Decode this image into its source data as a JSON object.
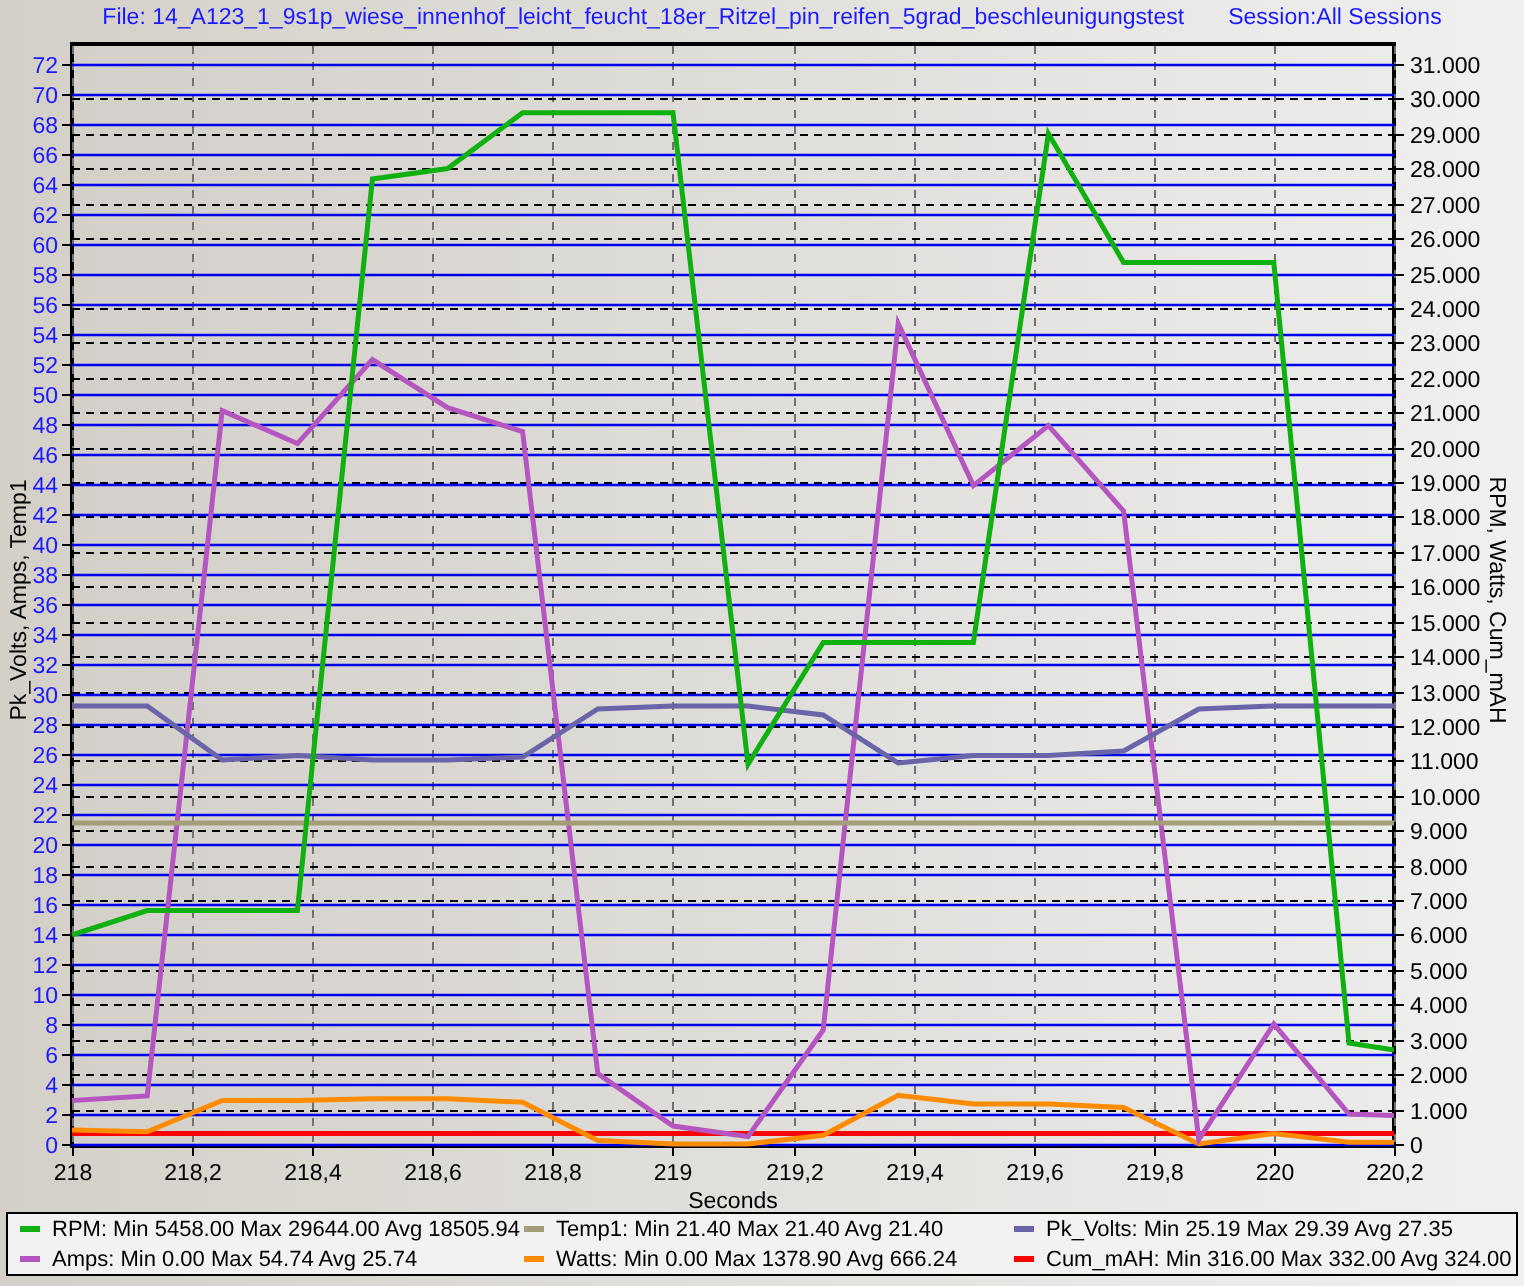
{
  "header": {
    "file": "File: 14_A123_1_9s1p_wiese_innenhof_leicht_feucht_18er_Ritzel_pin_reifen_5grad_beschleunigungstest",
    "session": "Session:All Sessions"
  },
  "chart": {
    "chart_data": {
      "type": "line",
      "grid": true,
      "xlabel": "Seconds",
      "ylabel": "Pk_Volts, Amps, Temp1",
      "y2label": "RPM, Watts, Cum_mAH",
      "x": [
        218,
        218.125,
        218.25,
        218.375,
        218.5,
        218.625,
        218.75,
        218.875,
        219,
        219.125,
        219.25,
        219.375,
        219.5,
        219.625,
        219.75,
        219.875,
        220,
        220.125,
        220.2
      ],
      "xlim": [
        218,
        220.2
      ],
      "xticks": [
        218,
        {
          "value": 218.2,
          "label": "218,2"
        },
        {
          "value": 218.4,
          "label": "218,4"
        },
        {
          "value": 218.6,
          "label": "218,6"
        },
        {
          "value": 218.8,
          "label": "218,8"
        },
        219,
        {
          "value": 219.2,
          "label": "219,2"
        },
        {
          "value": 219.4,
          "label": "219,4"
        },
        {
          "value": 219.6,
          "label": "219,6"
        },
        {
          "value": 219.8,
          "label": "219,8"
        },
        220,
        {
          "value": 220.2,
          "label": "220,2"
        }
      ],
      "ylim": [
        0,
        72
      ],
      "yticks": [
        0,
        2,
        4,
        6,
        8,
        10,
        12,
        14,
        16,
        18,
        20,
        22,
        24,
        26,
        28,
        30,
        32,
        34,
        36,
        38,
        40,
        42,
        44,
        46,
        48,
        50,
        52,
        54,
        56,
        58,
        60,
        62,
        64,
        66,
        68,
        70,
        72
      ],
      "y2lim": [
        0,
        31000
      ],
      "y2ticks": [
        0,
        {
          "value": 1000,
          "label": "1.000"
        },
        {
          "value": 2000,
          "label": "2.000"
        },
        {
          "value": 3000,
          "label": "3.000"
        },
        {
          "value": 4000,
          "label": "4.000"
        },
        {
          "value": 5000,
          "label": "5.000"
        },
        {
          "value": 6000,
          "label": "6.000"
        },
        {
          "value": 7000,
          "label": "7.000"
        },
        {
          "value": 8000,
          "label": "8.000"
        },
        {
          "value": 9000,
          "label": "9.000"
        },
        {
          "value": 10000,
          "label": "10.000"
        },
        {
          "value": 11000,
          "label": "11.000"
        },
        {
          "value": 12000,
          "label": "12.000"
        },
        {
          "value": 13000,
          "label": "13.000"
        },
        {
          "value": 14000,
          "label": "14.000"
        },
        {
          "value": 15000,
          "label": "15.000"
        },
        {
          "value": 16000,
          "label": "16.000"
        },
        {
          "value": 17000,
          "label": "17.000"
        },
        {
          "value": 18000,
          "label": "18.000"
        },
        {
          "value": 19000,
          "label": "19.000"
        },
        {
          "value": 20000,
          "label": "20.000"
        },
        {
          "value": 21000,
          "label": "21.000"
        },
        {
          "value": 22000,
          "label": "22.000"
        },
        {
          "value": 23000,
          "label": "23.000"
        },
        {
          "value": 24000,
          "label": "24.000"
        },
        {
          "value": 25000,
          "label": "25.000"
        },
        {
          "value": 26000,
          "label": "26.000"
        },
        {
          "value": 27000,
          "label": "27.000"
        },
        {
          "value": 28000,
          "label": "28.000"
        },
        {
          "value": 29000,
          "label": "29.000"
        },
        {
          "value": 30000,
          "label": "30.000"
        },
        {
          "value": 31000,
          "label": "31.000"
        }
      ],
      "series": [
        {
          "name": "RPM",
          "color": "#10b010",
          "axis": "y2",
          "values": [
            6000,
            6700,
            6700,
            6700,
            27700,
            28000,
            29600,
            29600,
            29600,
            10900,
            14400,
            14400,
            14400,
            29000,
            25300,
            25300,
            25300,
            2900,
            2700
          ]
        },
        {
          "name": "Temp1",
          "color": "#a39e78",
          "values": [
            21.4,
            21.4,
            21.4,
            21.4,
            21.4,
            21.4,
            21.4,
            21.4,
            21.4,
            21.4,
            21.4,
            21.4,
            21.4,
            21.4,
            21.4,
            21.4,
            21.4,
            21.4,
            21.4
          ]
        },
        {
          "name": "Pk_Volts",
          "color": "#6a64a8",
          "values": [
            29.2,
            29.2,
            25.6,
            25.9,
            25.6,
            25.6,
            25.8,
            29.0,
            29.2,
            29.2,
            28.6,
            25.4,
            25.9,
            25.9,
            26.2,
            29.0,
            29.2,
            29.2,
            29.2
          ]
        },
        {
          "name": "Amps",
          "color": "#b455c0",
          "values": [
            2.9,
            3.2,
            48.9,
            46.7,
            52.3,
            49.1,
            47.5,
            4.7,
            1.2,
            0.5,
            7.6,
            54.7,
            43.9,
            47.9,
            42.2,
            0.3,
            8.0,
            2.0,
            1.9
          ]
        },
        {
          "name": "Watts",
          "color": "#ff8c00",
          "axis": "y2",
          "values": [
            400,
            350,
            1250,
            1250,
            1300,
            1300,
            1200,
            100,
            0,
            0,
            250,
            1400,
            1150,
            1150,
            1050,
            0,
            300,
            50,
            50
          ]
        },
        {
          "name": "Cum_mAH",
          "color": "#ff0000",
          "axis": "y2",
          "values": [
            300,
            300,
            300,
            300,
            300,
            300,
            300,
            300,
            300,
            300,
            300,
            300,
            300,
            300,
            300,
            300,
            300,
            300,
            300
          ]
        }
      ]
    }
  },
  "legend": [
    {
      "stats": ":  Min 5458.00 Max 29644.00 Avg 18505.94"
    },
    {
      "stats": ":  Min 21.40 Max 21.40 Avg 21.40"
    },
    {
      "stats": ":  Min 25.19 Max 29.39 Avg 27.35"
    },
    {
      "stats": ":  Min 0.00 Max 54.74 Avg 25.74"
    },
    {
      "stats": ":  Min 0.00 Max 1378.90 Avg 666.24"
    },
    {
      "stats": ":  Min 316.00 Max 332.00 Avg 324.00"
    }
  ]
}
